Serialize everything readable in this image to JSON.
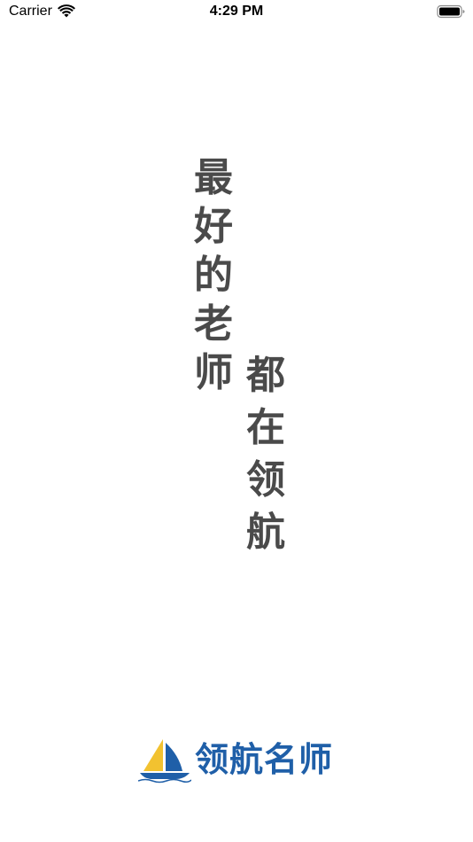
{
  "status_bar": {
    "carrier": "Carrier",
    "time": "4:29 PM",
    "icons": [
      "wifi-icon",
      "battery-icon"
    ]
  },
  "slogan": {
    "column_1": [
      "最",
      "好",
      "的",
      "老",
      "师"
    ],
    "column_2": [
      "都",
      "在",
      "领",
      "航"
    ]
  },
  "brand": {
    "name": "领航名师",
    "logo_icon": "sailboat-logo-icon",
    "colors": {
      "brand_blue": "#1f5fa8",
      "sail_yellow": "#f2c230",
      "slogan_gray": "#4a4a4a"
    }
  }
}
